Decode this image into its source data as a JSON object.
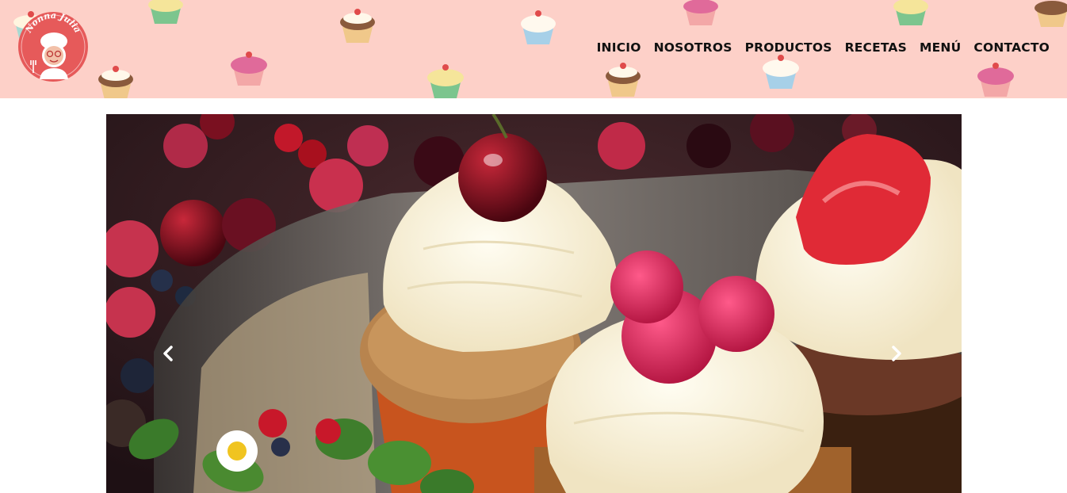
{
  "brand": {
    "logo_text": "Nonna Julia"
  },
  "nav": {
    "items": [
      {
        "label": "INICIO"
      },
      {
        "label": "NOSOTROS"
      },
      {
        "label": "PRODUCTOS"
      },
      {
        "label": "RECETAS"
      },
      {
        "label": "MENÚ"
      },
      {
        "label": "CONTACTO"
      }
    ]
  },
  "carousel": {
    "prev_icon": "chevron-left-icon",
    "next_icon": "chevron-right-icon"
  },
  "colors": {
    "header_bg": "#fdd0c8",
    "logo_red": "#e65a5a"
  }
}
